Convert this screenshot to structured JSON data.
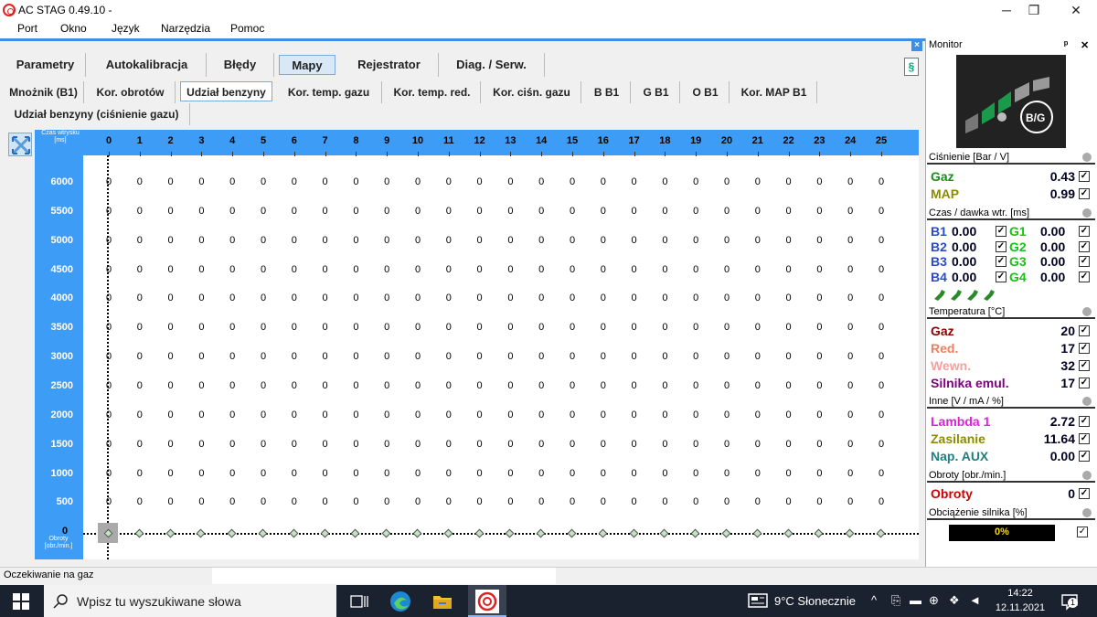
{
  "window": {
    "title": "AC STAG 0.49.10 -"
  },
  "menu": [
    "Port",
    "Okno",
    "Język",
    "Narzędzia",
    "Pomoc"
  ],
  "main_tabs": [
    "Parametry",
    "Autokalibracja",
    "Błędy",
    "Mapy",
    "Rejestrator",
    "Diag. / Serw."
  ],
  "map_tabs": [
    "Mnożnik (B1)",
    "Kor. obrotów",
    "Udział benzyny",
    "Kor. temp. gazu",
    "Kor. temp. red.",
    "Kor. ciśn. gazu",
    "B B1",
    "G B1",
    "O B1",
    "Kor. MAP B1"
  ],
  "map_tabs_row2": [
    "Udział benzyny (ciśnienie gazu)"
  ],
  "grid": {
    "corner_label": "Czas wtrysku [ms]",
    "row_axis_label": "Obroty [obr./min.]",
    "zero_row_label": "0",
    "columns": [
      "0",
      "1",
      "2",
      "3",
      "4",
      "5",
      "6",
      "7",
      "8",
      "9",
      "10",
      "11",
      "12",
      "13",
      "14",
      "15",
      "16",
      "17",
      "18",
      "19",
      "20",
      "21",
      "22",
      "23",
      "24",
      "25"
    ],
    "rows": [
      "6000",
      "5500",
      "5000",
      "4500",
      "4000",
      "3500",
      "3000",
      "2500",
      "2000",
      "1500",
      "1000",
      "500"
    ],
    "cell_value": "0"
  },
  "status": {
    "text": "Oczekiwanie na gaz"
  },
  "monitor": {
    "title": "Monitor",
    "pin_symbol": "ᵖ",
    "close_symbol": "✕",
    "logo_text": "B/G",
    "pressure_section": "Ciśnienie [Bar / V]",
    "pressure": [
      {
        "label": "Gaz",
        "value": "0.43",
        "color": "#1a8c1a"
      },
      {
        "label": "MAP",
        "value": "0.99",
        "color": "#8c8c00"
      }
    ],
    "injection_section": "Czas / dawka wtr. [ms]",
    "injection": [
      {
        "b": "B1",
        "bv": "0.00",
        "g": "G1",
        "gv": "0.00"
      },
      {
        "b": "B2",
        "bv": "0.00",
        "g": "G2",
        "gv": "0.00"
      },
      {
        "b": "B3",
        "bv": "0.00",
        "g": "G3",
        "gv": "0.00"
      },
      {
        "b": "B4",
        "bv": "0.00",
        "g": "G4",
        "gv": "0.00"
      }
    ],
    "temperature_section": "Temperatura [°C]",
    "temperature": [
      {
        "label": "Gaz",
        "value": "20",
        "color": "#8b0000"
      },
      {
        "label": "Red.",
        "value": "17",
        "color": "#f08060"
      },
      {
        "label": "Wewn.",
        "value": "32",
        "color": "#f4a0a0"
      },
      {
        "label": "Silnika emul.",
        "value": "17",
        "color": "#800080"
      }
    ],
    "other_section": "Inne [V / mA / %]",
    "other": [
      {
        "label": "Lambda 1",
        "value": "2.72",
        "color": "#e020e0"
      },
      {
        "label": "Zasilanie",
        "value": "11.64",
        "color": "#8c8c00"
      },
      {
        "label": "Nap. AUX",
        "value": "0.00",
        "color": "#208080"
      }
    ],
    "rpm_section": "Obroty [obr./min.]",
    "rpm": {
      "label": "Obroty",
      "value": "0",
      "color": "#d00000"
    },
    "load_section": "Obciążenie silnika [%]",
    "load": {
      "value": "0%"
    }
  },
  "taskbar": {
    "search_placeholder": "Wpisz tu wyszukiwane słowa",
    "weather": "9°C  Słonecznie",
    "time": "14:22",
    "date": "12.11.2021",
    "notification_count": "1"
  },
  "colors": {
    "accent": "#3d9cf5",
    "panel": "#f0f0f0",
    "taskbar": "#1a2230"
  }
}
